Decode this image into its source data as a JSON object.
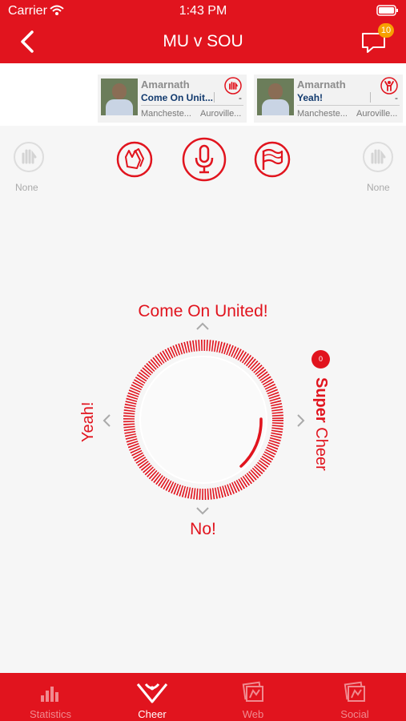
{
  "status_bar": {
    "carrier": "Carrier",
    "time": "1:43 PM"
  },
  "nav": {
    "title": "MU v SOU",
    "chat_badge": "10"
  },
  "feed": [
    {
      "name": "Amarnath",
      "cheer": "Come On Unit...",
      "score": "-",
      "team1": "Mancheste...",
      "team2": "Auroville...",
      "icon": "raised-hand-icon"
    },
    {
      "name": "Amarnath",
      "cheer": "Yeah!",
      "score": "-",
      "team1": "Mancheste...",
      "team2": "Auroville...",
      "icon": "cheering-person-icon"
    }
  ],
  "side_options": {
    "left_label": "None",
    "right_label": "None"
  },
  "modes": [
    "clap-icon",
    "microphone-icon",
    "flag-icon"
  ],
  "cheer_options": {
    "up": "Come On United!",
    "down": "No!",
    "left": "Yeah!",
    "super_count": "0",
    "super_bold": "Super",
    "super_rest": " Cheer"
  },
  "tabs": [
    {
      "label": "Statistics",
      "icon": "bar-chart-icon",
      "active": false
    },
    {
      "label": "Cheer",
      "icon": "cheer-icon",
      "active": true
    },
    {
      "label": "Web",
      "icon": "web-icon",
      "active": false
    },
    {
      "label": "Social",
      "icon": "social-icon",
      "active": false
    }
  ],
  "colors": {
    "accent": "#e1141e",
    "badge": "#f7a000"
  }
}
